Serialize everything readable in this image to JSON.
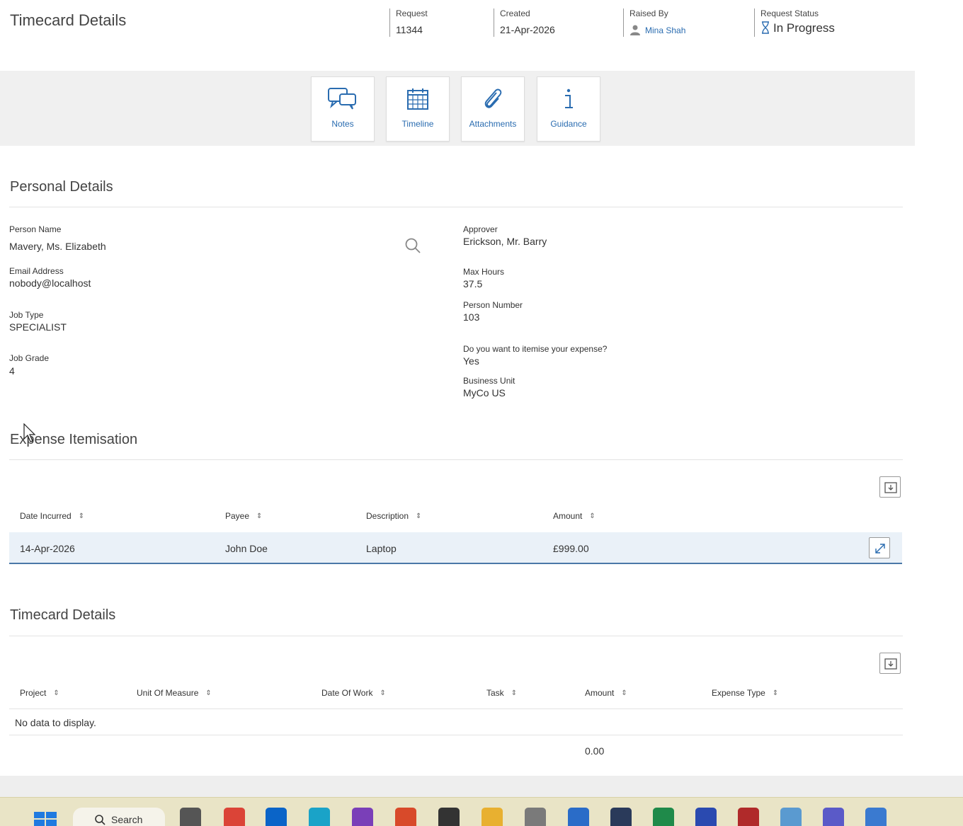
{
  "header": {
    "title": "Timecard Details",
    "request": {
      "label": "Request",
      "value": "11344"
    },
    "created": {
      "label": "Created",
      "value": "21-Apr-2026"
    },
    "raised_by": {
      "label": "Raised By",
      "value": "Mina Shah"
    },
    "status": {
      "label": "Request Status",
      "value": "In Progress"
    }
  },
  "toolbar": [
    {
      "label": "Notes",
      "icon": "chat-icon"
    },
    {
      "label": "Timeline",
      "icon": "calendar-icon"
    },
    {
      "label": "Attachments",
      "icon": "paperclip-icon"
    },
    {
      "label": "Guidance",
      "icon": "info-icon"
    }
  ],
  "personal": {
    "title": "Personal Details",
    "person_name": {
      "label": "Person Name",
      "value": "Mavery, Ms. Elizabeth"
    },
    "email": {
      "label": "Email Address",
      "value": "nobody@localhost"
    },
    "job_type": {
      "label": "Job Type",
      "value": "SPECIALIST"
    },
    "job_grade": {
      "label": "Job Grade",
      "value": "4"
    },
    "approver": {
      "label": "Approver",
      "value": "Erickson, Mr. Barry"
    },
    "max_hours": {
      "label": "Max Hours",
      "value": "37.5"
    },
    "person_number": {
      "label": "Person Number",
      "value": "103"
    },
    "itemise": {
      "label": "Do you want to itemise your expense?",
      "value": "Yes"
    },
    "business_unit": {
      "label": "Business Unit",
      "value": "MyCo US"
    }
  },
  "expense": {
    "title": "Expense Itemisation",
    "columns": [
      "Date Incurred",
      "Payee",
      "Description",
      "Amount"
    ],
    "rows": [
      [
        "14-Apr-2026",
        "John Doe",
        "Laptop",
        "£999.00"
      ]
    ]
  },
  "timecard": {
    "title": "Timecard Details",
    "columns": [
      "Project",
      "Unit Of Measure",
      "Date Of Work",
      "Task",
      "Amount",
      "Expense Type"
    ],
    "empty": "No data to display.",
    "total": "0.00"
  },
  "taskbar": {
    "search": "Search"
  },
  "colors": {
    "accent": "#2a6cb0",
    "selected_row": "#eaf1f8",
    "toolbar_band": "#f0f0f0"
  }
}
